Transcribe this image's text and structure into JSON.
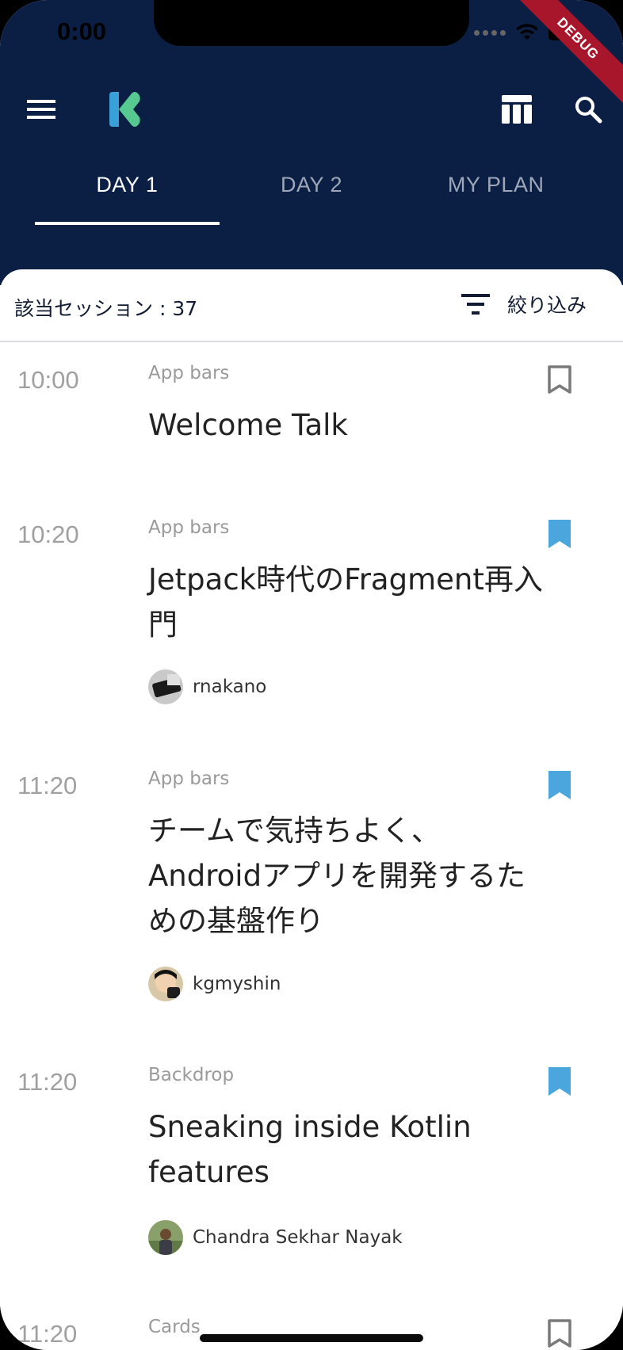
{
  "status_bar": {
    "time": "0:00"
  },
  "debug_banner": "DEBUG",
  "tabs": [
    {
      "label": "DAY 1",
      "active": true
    },
    {
      "label": "DAY 2",
      "active": false
    },
    {
      "label": "MY PLAN",
      "active": false
    }
  ],
  "filter_bar": {
    "count_text": "該当セッション : 37",
    "filter_label": "絞り込み"
  },
  "sessions": [
    {
      "time": "10:00",
      "category": "App bars",
      "title": "Welcome Talk",
      "bookmarked": false,
      "speaker": null
    },
    {
      "time": "10:20",
      "category": "App bars",
      "title": "Jetpack時代のFragment再入門",
      "bookmarked": true,
      "speaker": "rnakano"
    },
    {
      "time": "11:20",
      "category": "App bars",
      "title": "チームで気持ちよく、Androidアプリを開発するための基盤作り",
      "bookmarked": true,
      "speaker": "kgmyshin"
    },
    {
      "time": "11:20",
      "category": "Backdrop",
      "title": "Sneaking inside Kotlin features",
      "bookmarked": true,
      "speaker": "Chandra Sekhar Nayak"
    },
    {
      "time": "11:20",
      "category": "Cards",
      "title": "",
      "bookmarked": false,
      "speaker": null
    }
  ],
  "colors": {
    "app_bar": "#0b1f45",
    "bookmark_active": "#4aa6dc",
    "bookmark_inactive": "#7a7a7a",
    "debug_ribbon": "#a8162b"
  },
  "icons": {
    "menu": "menu-icon",
    "logo": "droidkaigi-logo-icon",
    "timetable": "table-icon",
    "search": "search-icon",
    "filter": "filter-icon",
    "bookmark": "bookmark-icon"
  }
}
